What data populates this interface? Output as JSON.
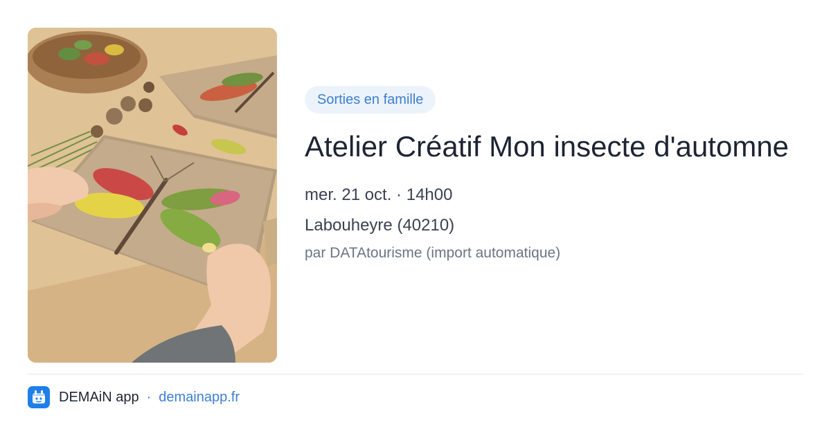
{
  "event": {
    "category": "Sorties en famille",
    "title": "Atelier Créatif Mon insecte d'automne",
    "date_time": "mer. 21 oct. · 14h00",
    "location": "Labouheyre (40210)",
    "source": "par DATAtourisme (import automatique)"
  },
  "footer": {
    "app_name": "DEMAiN app",
    "separator": "·",
    "site": "demainapp.fr"
  },
  "colors": {
    "accent": "#3b7fd0",
    "chip_bg": "#edf3fb",
    "title": "#1d2433",
    "logo": "#1e7fe8"
  }
}
